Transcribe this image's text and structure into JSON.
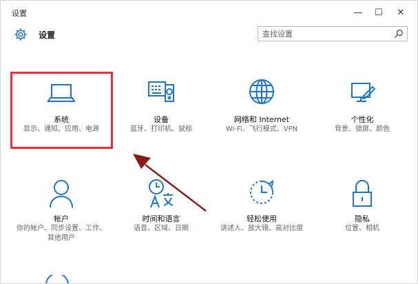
{
  "window": {
    "title": "设置",
    "controls": {
      "minimize": "—",
      "maximize": "☐",
      "close": "✕"
    }
  },
  "header": {
    "title": "设置",
    "search_placeholder": "查找设置"
  },
  "tiles": [
    {
      "name": "系统",
      "desc": "显示、通知、应用、电源",
      "icon": "laptop-icon"
    },
    {
      "name": "设备",
      "desc": "蓝牙、打印机、鼠标",
      "icon": "devices-icon"
    },
    {
      "name": "网络和 Internet",
      "desc": "Wi-Fi、飞行模式、VPN",
      "icon": "globe-icon"
    },
    {
      "name": "个性化",
      "desc": "背景、锁屏、颜色",
      "icon": "personalization-icon"
    },
    {
      "name": "帐户",
      "desc": "你的帐户、同步设置、工作、其他用户",
      "icon": "person-icon"
    },
    {
      "name": "时间和语言",
      "desc": "语音、区域、日期",
      "icon": "time-language-icon"
    },
    {
      "name": "轻松使用",
      "desc": "讲述人、放大镜、高对比度",
      "icon": "ease-of-access-icon"
    },
    {
      "name": "隐私",
      "desc": "位置、相机",
      "icon": "lock-icon"
    }
  ],
  "colors": {
    "accent": "#1f73c4",
    "highlight": "#e0343a",
    "arrow": "#8b1a1a"
  }
}
